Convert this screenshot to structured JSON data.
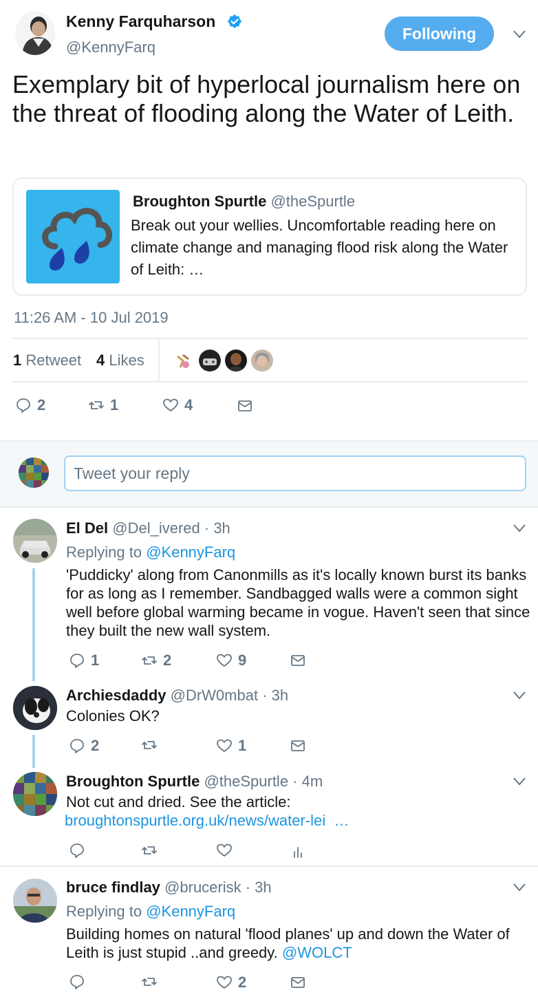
{
  "main_tweet": {
    "name": "Kenny Farquharson",
    "handle": "@KennyFarq",
    "follow_label": "Following",
    "text": "Exemplary bit of hyperlocal journalism here on the threat of flooding along the Water of Leith.",
    "quoted": {
      "name": "Broughton Spurtle",
      "handle": "@theSpurtle",
      "text": "Break out your wellies. Uncomfortable reading here on climate change and managing flood risk along the Water of Leith: …"
    },
    "timestamp": "11:26 AM - 10 Jul 2019",
    "stats": {
      "retweets": "1",
      "retweets_label": "Retweet",
      "likes": "4",
      "likes_label": "Likes"
    },
    "actions": {
      "replies": "2",
      "retweets": "1",
      "likes": "4"
    }
  },
  "reply_box": {
    "placeholder": "Tweet your reply"
  },
  "replies": [
    {
      "name": "El Del",
      "handle": "@Del_ivered · 3h",
      "replying_to_label": "Replying to",
      "replying_to": "@KennyFarq",
      "text": "'Puddicky' along from Canonmills as it's locally known burst its banks for as long as I remember. Sandbagged walls were a common sight well before global warming became in vogue. Haven't seen that since they built the new wall system.",
      "actions": {
        "replies": "1",
        "retweets": "2",
        "likes": "9"
      }
    },
    {
      "name": "Archiesdaddy",
      "handle": "@DrW0mbat · 3h",
      "text": "Colonies OK?",
      "actions": {
        "replies": "2",
        "retweets": "",
        "likes": "1"
      }
    },
    {
      "name": "Broughton Spurtle",
      "handle": "@theSpurtle · 4m",
      "text": "Not cut and dried. See the article:",
      "link": "broughtonspurtle.org.uk/news/water-lei  …",
      "actions": {
        "replies": "",
        "retweets": "",
        "likes": ""
      }
    },
    {
      "name": "bruce findlay",
      "handle": "@brucerisk · 3h",
      "replying_to_label": "Replying to",
      "replying_to": "@KennyFarq",
      "text": "Building homes on natural 'flood planes' up and down the Water of Leith is just stupid ..and greedy.",
      "mention": "@WOLCT",
      "actions": {
        "replies": "",
        "retweets": "",
        "likes": "2"
      }
    }
  ],
  "colors": {
    "accent": "#1b95e0",
    "follow_bg": "#55acee",
    "weather_icon_bg": "#36b4ec",
    "divider": "#e6ecf0"
  },
  "icons": [
    "verified-icon",
    "chevron-down-icon",
    "reply-icon",
    "retweet-icon",
    "like-icon",
    "message-icon",
    "analytics-icon",
    "rain-cloud-icon"
  ]
}
